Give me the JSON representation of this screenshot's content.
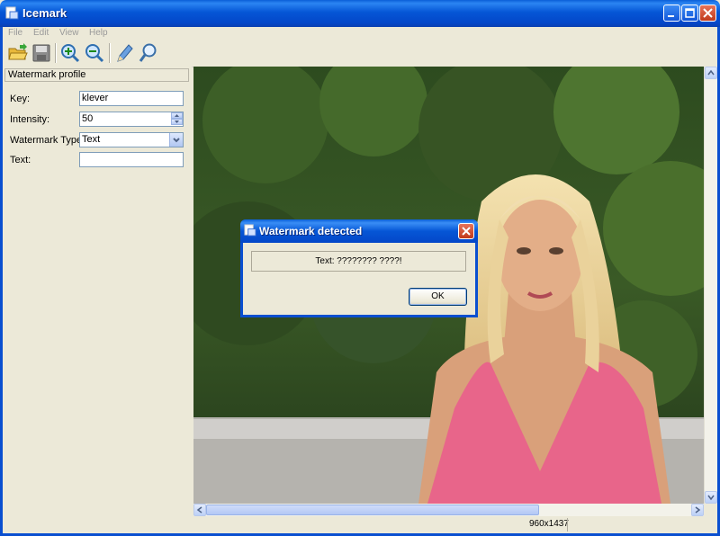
{
  "window": {
    "title": "Icemark"
  },
  "menu": [
    {
      "label": "File"
    },
    {
      "label": "Edit"
    },
    {
      "label": "View"
    },
    {
      "label": "Help"
    }
  ],
  "toolbar": {
    "buttons": [
      {
        "icon": "open-folder-icon"
      },
      {
        "icon": "save-icon"
      },
      {
        "icon": "zoom-in-icon"
      },
      {
        "icon": "zoom-out-icon"
      },
      {
        "icon": "pencil-icon"
      },
      {
        "icon": "search-icon"
      }
    ]
  },
  "panel": {
    "header": "Watermark profile",
    "key": {
      "label": "Key:",
      "value": "klever"
    },
    "intensity": {
      "label": "Intensity:",
      "value": "50"
    },
    "type": {
      "label": "Watermark Type:",
      "value": "Text"
    },
    "text": {
      "label": "Text:",
      "value": ""
    }
  },
  "status": {
    "dimensions": "960x1437"
  },
  "dialog": {
    "title": "Watermark detected",
    "message": "Text: ???????? ????!",
    "ok_label": "OK"
  },
  "colors": {
    "titlebar": "#0556d6",
    "window_bg": "#ece9d8",
    "close_button": "#c0391a"
  }
}
